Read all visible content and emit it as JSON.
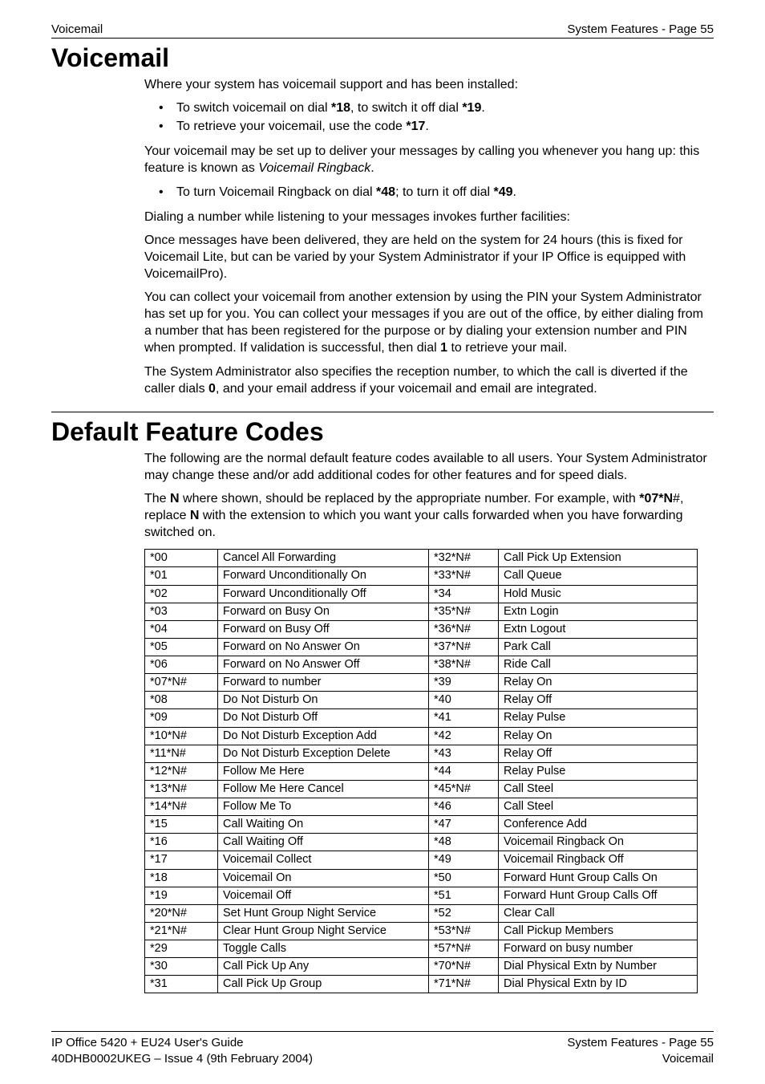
{
  "header": {
    "left": "Voicemail",
    "right": "System Features - Page 55"
  },
  "voicemail": {
    "title": "Voicemail",
    "intro": "Where your system has voicemail support and has been installed:",
    "bullet1_pre": "To switch voicemail on dial ",
    "bullet1_b1": "*18",
    "bullet1_mid": ", to switch it off dial ",
    "bullet1_b2": "*19",
    "bullet1_end": ".",
    "bullet2_pre": "To retrieve your voicemail, use the code ",
    "bullet2_b": "*17",
    "bullet2_end": ".",
    "para2_pre": "Your voicemail may be set up to deliver your messages by calling you whenever you hang up: this feature is known as ",
    "para2_i": "Voicemail Ringback",
    "para2_end": ".",
    "bullet3_pre": "To turn Voicemail Ringback on dial ",
    "bullet3_b1": "*48",
    "bullet3_mid": "; to turn it off dial ",
    "bullet3_b2": "*49",
    "bullet3_end": ".",
    "para3": "Dialing a number while listening to your messages invokes further facilities:",
    "para4": "Once messages have been delivered, they are held on the system for 24 hours (this is fixed for Voicemail Lite, but can be varied by your System Administrator if your IP Office is equipped with VoicemailPro).",
    "para5_pre": "You can collect your voicemail from another extension by using the PIN your System Administrator has set up for you. You can collect your messages if you are out of the office, by either dialing from a number that has been registered for the purpose or by dialing your extension number and PIN when prompted. If validation is successful, then dial ",
    "para5_b": "1",
    "para5_end": " to retrieve your mail.",
    "para6_pre": "The System Administrator also specifies the reception number, to which the call is diverted if the caller dials ",
    "para6_b": "0",
    "para6_end": ", and your email address if your voicemail and email are integrated."
  },
  "codes": {
    "title": "Default Feature Codes",
    "para1": "The following are the normal default feature codes available to all users. Your System Administrator may change these and/or add additional codes for other features and for speed dials.",
    "para2_pre": "The ",
    "para2_b1": "N",
    "para2_mid1": " where shown, should be replaced by the appropriate number. For example, with ",
    "para2_b2": "*07*N",
    "para2_mid2": "#, replace ",
    "para2_b3": "N",
    "para2_end": " with the extension to which you want your calls forwarded when you have forwarding switched on.",
    "rows": [
      {
        "c1": "*00",
        "c2": "Cancel All Forwarding",
        "c3": "*32*N#",
        "c4": "Call Pick Up Extension"
      },
      {
        "c1": "*01",
        "c2": "Forward Unconditionally On",
        "c3": "*33*N#",
        "c4": "Call Queue"
      },
      {
        "c1": "*02",
        "c2": "Forward Unconditionally Off",
        "c3": "*34",
        "c4": "Hold Music"
      },
      {
        "c1": "*03",
        "c2": "Forward on Busy On",
        "c3": "*35*N#",
        "c4": "Extn Login"
      },
      {
        "c1": "*04",
        "c2": "Forward on Busy Off",
        "c3": "*36*N#",
        "c4": "Extn Logout"
      },
      {
        "c1": "*05",
        "c2": "Forward on No Answer On",
        "c3": "*37*N#",
        "c4": "Park Call"
      },
      {
        "c1": "*06",
        "c2": "Forward on No Answer Off",
        "c3": "*38*N#",
        "c4": "Ride Call"
      },
      {
        "c1": "*07*N#",
        "c2": "Forward to number",
        "c3": "*39",
        "c4": "Relay On"
      },
      {
        "c1": "*08",
        "c2": "Do Not Disturb On",
        "c3": "*40",
        "c4": "Relay Off"
      },
      {
        "c1": "*09",
        "c2": "Do Not Disturb Off",
        "c3": "*41",
        "c4": "Relay Pulse"
      },
      {
        "c1": "*10*N#",
        "c2": "Do Not Disturb Exception Add",
        "c3": "*42",
        "c4": "Relay On"
      },
      {
        "c1": "*11*N#",
        "c2": "Do Not Disturb Exception Delete",
        "c3": "*43",
        "c4": "Relay Off"
      },
      {
        "c1": "*12*N#",
        "c2": "Follow Me Here",
        "c3": "*44",
        "c4": "Relay Pulse"
      },
      {
        "c1": "*13*N#",
        "c2": "Follow Me Here Cancel",
        "c3": "*45*N#",
        "c4": "Call Steel"
      },
      {
        "c1": "*14*N#",
        "c2": "Follow Me To",
        "c3": "*46",
        "c4": "Call Steel"
      },
      {
        "c1": "*15",
        "c2": "Call Waiting On",
        "c3": "*47",
        "c4": "Conference Add"
      },
      {
        "c1": "*16",
        "c2": "Call Waiting Off",
        "c3": "*48",
        "c4": "Voicemail Ringback On"
      },
      {
        "c1": "*17",
        "c2": "Voicemail Collect",
        "c3": "*49",
        "c4": "Voicemail Ringback Off"
      },
      {
        "c1": "*18",
        "c2": "Voicemail On",
        "c3": "*50",
        "c4": "Forward Hunt Group Calls On"
      },
      {
        "c1": "*19",
        "c2": "Voicemail Off",
        "c3": "*51",
        "c4": "Forward Hunt Group Calls Off"
      },
      {
        "c1": "*20*N#",
        "c2": "Set Hunt Group Night Service",
        "c3": "*52",
        "c4": "Clear Call"
      },
      {
        "c1": "*21*N#",
        "c2": "Clear Hunt Group Night Service",
        "c3": "*53*N#",
        "c4": "Call Pickup Members"
      },
      {
        "c1": "*29",
        "c2": "Toggle Calls",
        "c3": "*57*N#",
        "c4": "Forward on busy number"
      },
      {
        "c1": "*30",
        "c2": "Call Pick Up Any",
        "c3": "*70*N#",
        "c4": "Dial Physical Extn by Number"
      },
      {
        "c1": "*31",
        "c2": "Call Pick Up Group",
        "c3": "*71*N#",
        "c4": "Dial Physical Extn by ID"
      }
    ]
  },
  "footer": {
    "l1": "IP Office 5420 + EU24 User's Guide",
    "l2": "40DHB0002UKEG – Issue 4 (9th February 2004)",
    "r1": "System Features - Page 55",
    "r2": "Voicemail"
  }
}
